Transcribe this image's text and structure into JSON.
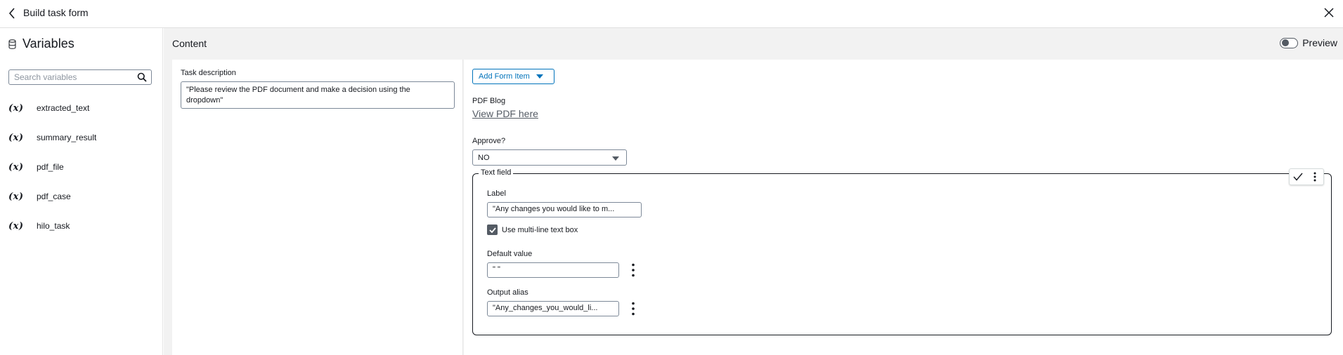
{
  "header": {
    "title": "Build task form",
    "back_icon": "chevron-left-icon",
    "close_icon": "close-icon"
  },
  "sidebar": {
    "title": "Variables",
    "title_icon": "database-icon",
    "search": {
      "placeholder": "Search variables",
      "value": ""
    },
    "variable_icon_text": "(x)",
    "variables": [
      {
        "name": "extracted_text"
      },
      {
        "name": "summary_result"
      },
      {
        "name": "pdf_file"
      },
      {
        "name": "pdf_case"
      },
      {
        "name": "hilo_task"
      }
    ]
  },
  "main": {
    "title": "Content",
    "preview": {
      "label": "Preview",
      "enabled": false
    }
  },
  "task_description": {
    "label": "Task description",
    "value": "\"Please review the PDF document and make a decision using the dropdown\""
  },
  "form": {
    "add_button_label": "Add Form Item",
    "pdf": {
      "label": "PDF Blog",
      "link_text": "View PDF here"
    },
    "approve": {
      "label": "Approve?",
      "selected": "NO"
    },
    "text_field": {
      "legend": "Text field",
      "label_label": "Label",
      "label_value": "\"Any changes you would like to m...",
      "multiline_label": "Use multi-line text box",
      "multiline_checked": true,
      "default_value_label": "Default value",
      "default_value": "\" \"",
      "output_alias_label": "Output alias",
      "output_alias_value": "\"Any_changes_you_would_li..."
    }
  },
  "colors": {
    "accent": "#0073bb",
    "border": "#7d8998",
    "text": "#16191f",
    "panel_bg": "#f2f2f2"
  }
}
